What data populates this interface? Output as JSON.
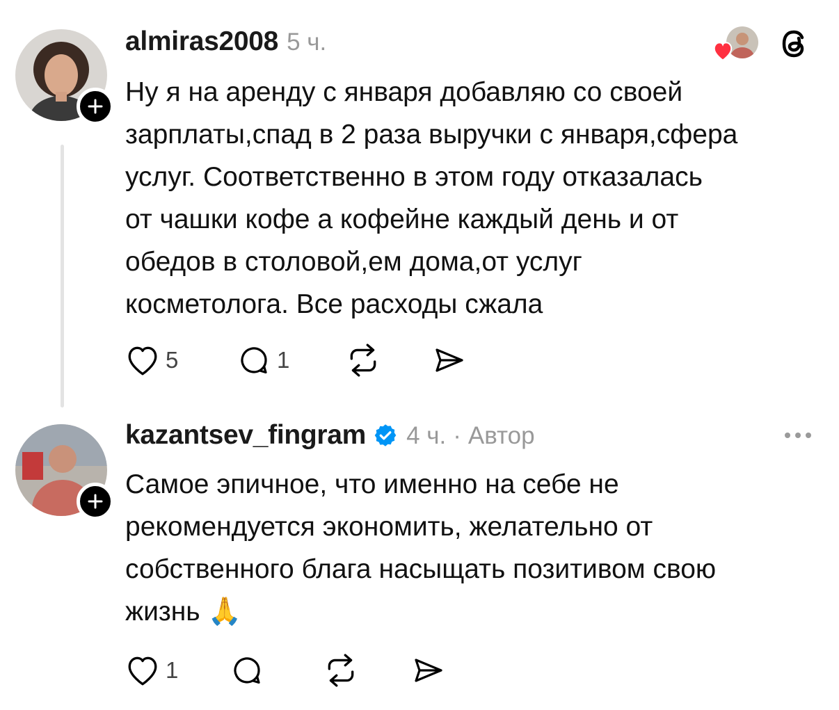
{
  "posts": [
    {
      "username": "almiras2008",
      "time": "5 ч.",
      "author_tag": "",
      "text": "Ну я на аренду с января добавляю со своей\nзарплаты,спад в 2 раза выручки с января,сфера\nуслуг. Соответственно в этом году отказалась\nот чашки кофе а кофейне каждый день и от\nобедов в столовой,ем дома,от услуг\nкосметолога. Все расходы сжала",
      "likes": "5",
      "replies": "1"
    },
    {
      "username": "kazantsev_fingram",
      "time": "4 ч.",
      "separator": "·",
      "author_tag": "Автор",
      "text": "Самое эпичное, что именно на себе не\nрекомендуется экономить, желательно от\nсобственного блага насыщать позитивом свою\nжизнь 🙏",
      "likes": "1",
      "replies": ""
    }
  ],
  "icons": {
    "like": "heart-outline-icon",
    "reply": "speech-bubble-icon",
    "repost": "repost-arrows-icon",
    "share": "send-arrow-icon",
    "follow": "plus-icon",
    "verified": "verified-badge-icon",
    "liked_by_author": "heart-filled-icon",
    "threads_logo": "threads-logo-icon",
    "more": "ellipsis-icon"
  },
  "colors": {
    "username": "#1a1a1a",
    "meta": "#999999",
    "verified": "#0095f6",
    "heart": "#ff3040"
  }
}
